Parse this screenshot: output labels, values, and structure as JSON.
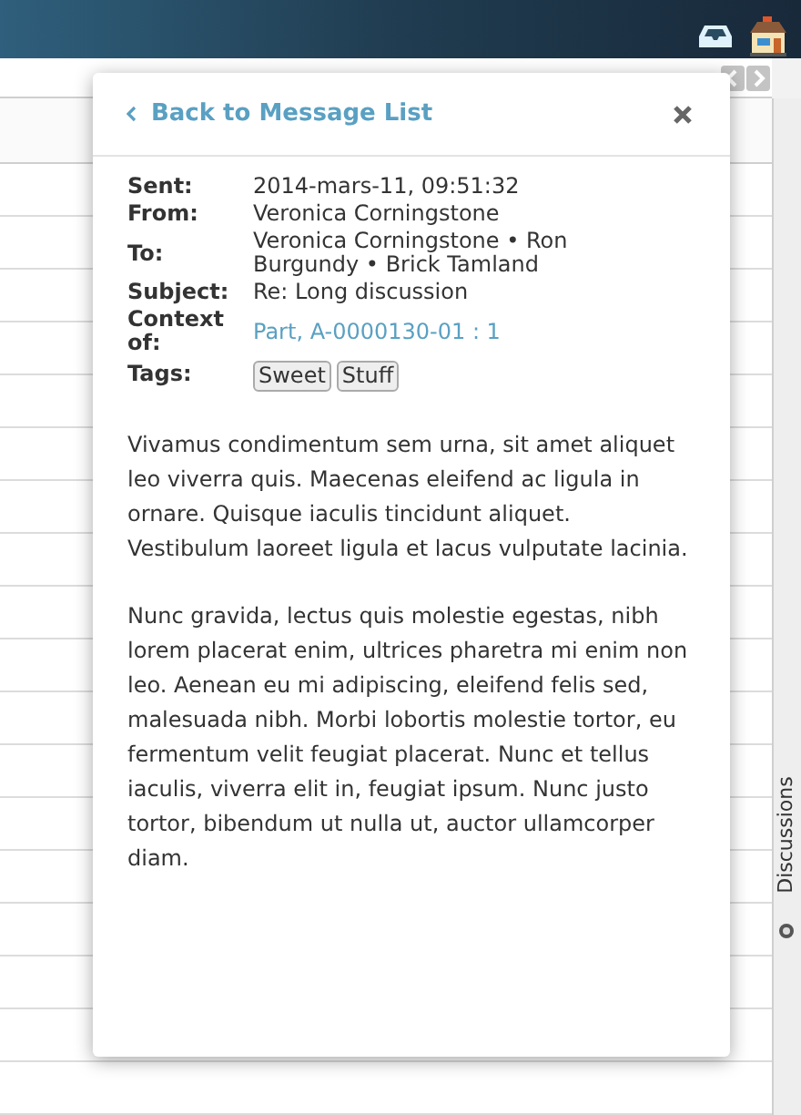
{
  "side_tab": {
    "label": "Discussions"
  },
  "message": {
    "back_link": "Back to Message List",
    "fields": [
      {
        "kind": "text",
        "label": "Sent:",
        "value": "2014-mars-11, 09:51:32"
      },
      {
        "kind": "text",
        "label": "From:",
        "value": "Veronica Corningstone"
      },
      {
        "kind": "text",
        "label": "To:",
        "value": "Veronica Corningstone • Ron Burgundy • Brick Tamland"
      },
      {
        "kind": "text",
        "label": "Subject:",
        "value": "Re: Long discussion"
      },
      {
        "kind": "link",
        "label": "Context of:",
        "value": "Part, A-0000130-01 : 1"
      },
      {
        "kind": "tags",
        "label": "Tags:",
        "tags": [
          "Sweet",
          "Stuff"
        ]
      }
    ],
    "body": [
      "Vivamus condimentum sem urna, sit amet aliquet leo viverra quis. Maecenas eleifend ac ligula in ornare. Quisque iaculis tincidunt aliquet. Vestibulum laoreet ligula et lacus vulputate lacinia.",
      "Nunc gravida, lectus quis molestie egestas, nibh lorem placerat enim, ultrices pharetra mi enim non leo. Aenean eu mi adipiscing, eleifend felis sed, malesuada nibh. Morbi lobortis molestie tortor, eu fermentum velit feugiat placerat. Nunc et tellus iaculis, viverra elit in, feugiat ipsum. Nunc justo tortor, bibendum ut nulla ut, auctor ullamcorper diam."
    ]
  }
}
